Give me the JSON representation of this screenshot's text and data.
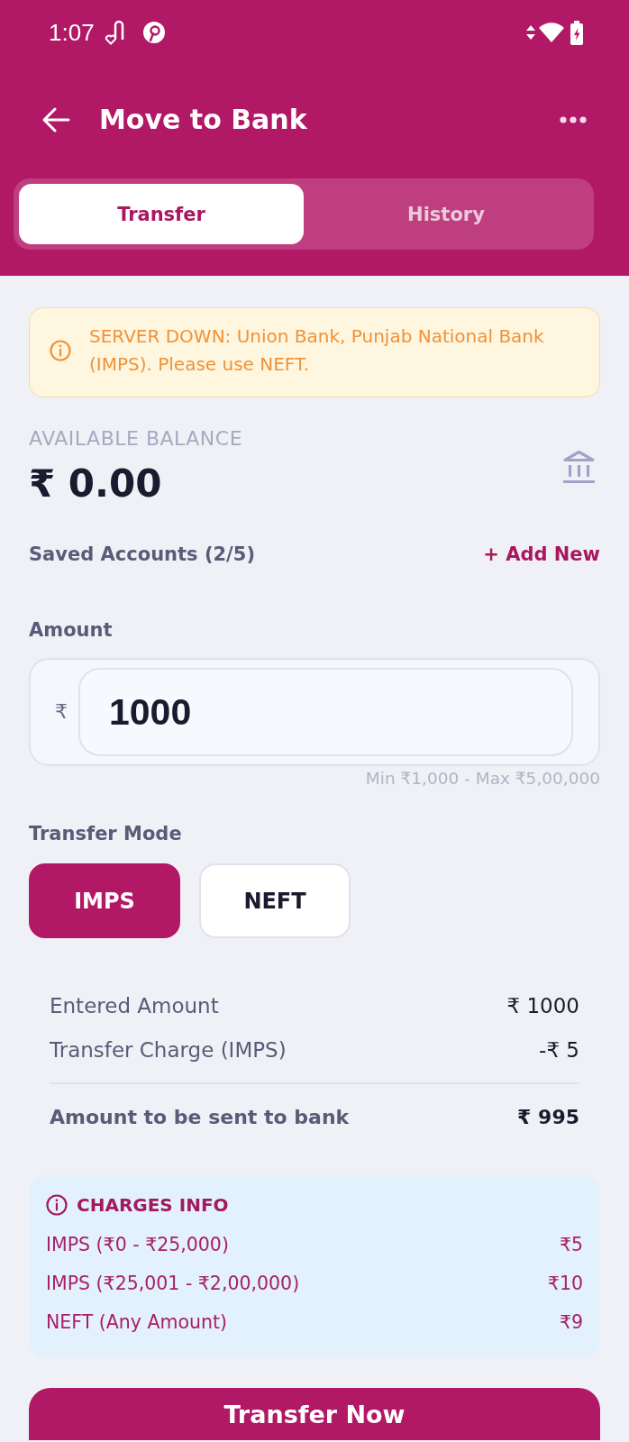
{
  "status_bar": {
    "time": "1:07"
  },
  "header": {
    "title": "Move to Bank"
  },
  "tabs": [
    {
      "label": "Transfer",
      "selected": true
    },
    {
      "label": "History",
      "selected": false
    }
  ],
  "alert": {
    "message": "SERVER DOWN: Union Bank, Punjab National Bank (IMPS). Please use NEFT."
  },
  "balance": {
    "label": "AVAILABLE BALANCE",
    "amount": "₹ 0.00"
  },
  "saved_accounts": {
    "label": "Saved Accounts (2/5)",
    "action": "+ Add New"
  },
  "amount": {
    "label": "Amount",
    "currency": "₹",
    "value": "1000",
    "hint": "Min ₹1,000 - Max ₹5,00,000"
  },
  "transfer_mode": {
    "label": "Transfer Mode",
    "options": [
      {
        "label": "IMPS",
        "selected": true
      },
      {
        "label": "NEFT",
        "selected": false
      }
    ]
  },
  "summary": [
    {
      "kind": "item",
      "label": "Entered Amount",
      "value": "₹ 1000"
    },
    {
      "kind": "item",
      "label": "Transfer Charge (IMPS)",
      "value": "-₹ 5"
    },
    {
      "kind": "total",
      "label": "Amount to be sent to bank",
      "value": "₹ 995"
    }
  ],
  "charges_info": {
    "title": "CHARGES INFO",
    "rows": [
      {
        "label": "IMPS (₹0 - ₹25,000)",
        "value": "₹5"
      },
      {
        "label": "IMPS (₹25,001 - ₹2,00,000)",
        "value": "₹10"
      },
      {
        "label": "NEFT (Any Amount)",
        "value": "₹9"
      }
    ]
  },
  "primary_button": {
    "label": "Transfer Now"
  }
}
